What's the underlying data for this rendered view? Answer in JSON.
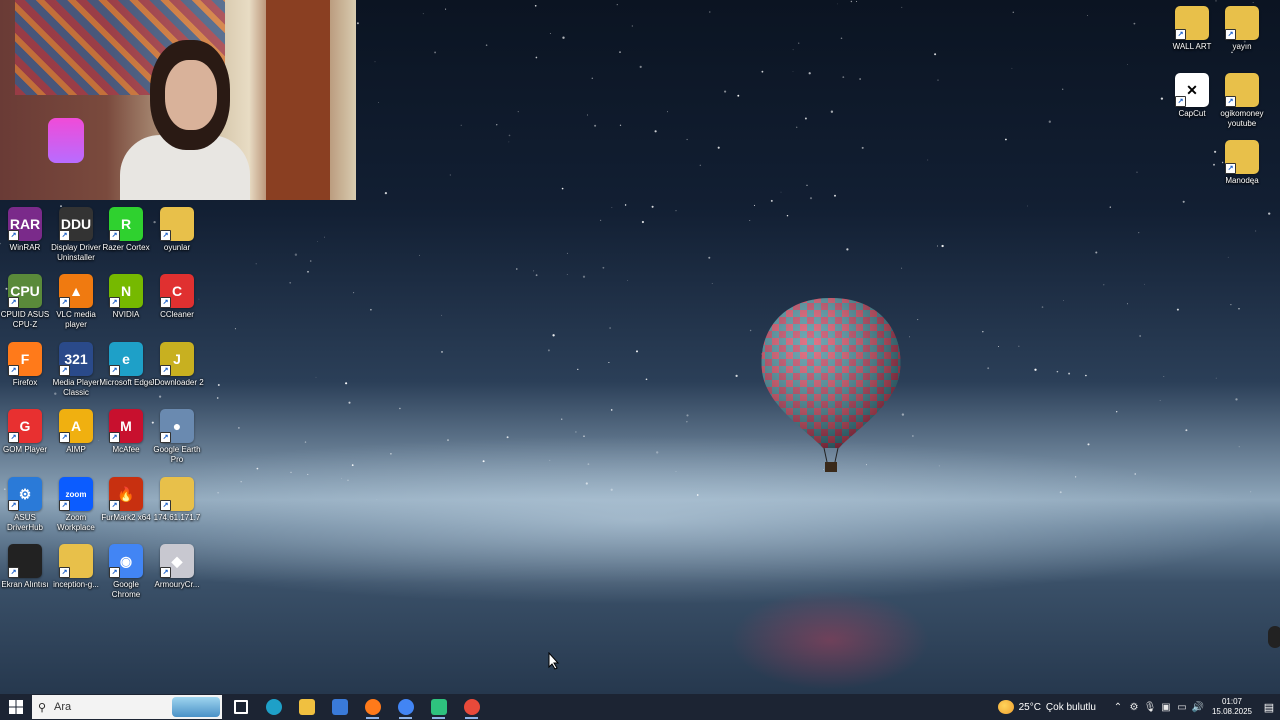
{
  "desktop": {
    "left_icons": [
      {
        "label": "WinRAR",
        "icon": "winrar-icon",
        "color": "#7a2a8a",
        "short": "RAR"
      },
      {
        "label": "Display Driver Uninstaller",
        "icon": "ddu-icon",
        "color": "#333333",
        "short": "DDU"
      },
      {
        "label": "Razer Cortex",
        "icon": "razer-cortex-icon",
        "color": "#2fd12f",
        "short": "R"
      },
      {
        "label": "oyunlar",
        "icon": "folder-icon",
        "color": "#e8c04a",
        "short": ""
      },
      {
        "label": "CPUID ASUS CPU-Z",
        "icon": "cpuz-icon",
        "color": "#5a8a3a",
        "short": "CPU"
      },
      {
        "label": "VLC media player",
        "icon": "vlc-icon",
        "color": "#f07a10",
        "short": "▲"
      },
      {
        "label": "NVIDIA",
        "icon": "nvidia-icon",
        "color": "#76b900",
        "short": "N"
      },
      {
        "label": "CCleaner",
        "icon": "ccleaner-icon",
        "color": "#e03030",
        "short": "C"
      },
      {
        "label": "Firefox",
        "icon": "firefox-icon",
        "color": "#ff7a1a",
        "short": "F"
      },
      {
        "label": "Media Player Classic",
        "icon": "mpc-icon",
        "color": "#2a4a8a",
        "short": "321"
      },
      {
        "label": "Microsoft Edge",
        "icon": "edge-icon",
        "color": "#1ea0c8",
        "short": "e"
      },
      {
        "label": "JDownloader 2",
        "icon": "jdownloader-icon",
        "color": "#c8b020",
        "short": "J"
      },
      {
        "label": "GOM Player",
        "icon": "gom-player-icon",
        "color": "#e83030",
        "short": "G"
      },
      {
        "label": "AIMP",
        "icon": "aimp-icon",
        "color": "#f0b010",
        "short": "A"
      },
      {
        "label": "McAfee",
        "icon": "mcafee-icon",
        "color": "#c8102e",
        "short": "M"
      },
      {
        "label": "Google Earth Pro",
        "icon": "google-earth-icon",
        "color": "#6a8ab0",
        "short": "●"
      },
      {
        "label": "ASUS DriverHub",
        "icon": "asus-driverhub-icon",
        "color": "#2a7ad8",
        "short": "⚙"
      },
      {
        "label": "Zoom Workplace",
        "icon": "zoom-icon",
        "color": "#0b5cff",
        "short": "zoom"
      },
      {
        "label": "FurMark2 x64",
        "icon": "furmark-icon",
        "color": "#c83010",
        "short": "🔥"
      },
      {
        "label": "174.61.171.7",
        "icon": "winrar-archive-icon",
        "color": "#e8c04a",
        "short": ""
      },
      {
        "label": "Ekran Alıntısı",
        "icon": "screenshot-thumbnail-icon",
        "color": "#222222",
        "short": ""
      },
      {
        "label": "inception-g...",
        "icon": "folder-icon",
        "color": "#e8c04a",
        "short": ""
      },
      {
        "label": "Google Chrome",
        "icon": "chrome-icon",
        "color": "#4285f4",
        "short": "◉"
      },
      {
        "label": "ArmouryCr...",
        "icon": "armoury-crate-icon",
        "color": "#c8c8d0",
        "short": "◆"
      }
    ],
    "right_icons": [
      {
        "label": "WALL ART",
        "icon": "folder-icon",
        "color": "#e8c04a",
        "short": ""
      },
      {
        "label": "yayın",
        "icon": "winrar-archive-icon",
        "color": "#e8c04a",
        "short": ""
      },
      {
        "label": "CapCut",
        "icon": "capcut-icon",
        "color": "#ffffff",
        "short": "✕"
      },
      {
        "label": "ogikomoney youtube",
        "icon": "winrar-archive-icon",
        "color": "#e8c04a",
        "short": ""
      },
      {
        "label": "Manodea",
        "icon": "winrar-archive-icon",
        "color": "#e8c04a",
        "short": ""
      }
    ]
  },
  "taskbar": {
    "search_placeholder": "Ara",
    "apps": [
      {
        "name": "task-view-icon",
        "color": "#ffffff"
      },
      {
        "name": "edge-icon",
        "color": "#1ea0c8"
      },
      {
        "name": "file-explorer-icon",
        "color": "#f0c040"
      },
      {
        "name": "microsoft-store-icon",
        "color": "#3a7ad8"
      },
      {
        "name": "firefox-icon",
        "color": "#ff7a1a"
      },
      {
        "name": "chrome-icon",
        "color": "#4285f4"
      },
      {
        "name": "chat-app-icon",
        "color": "#2ec27e"
      },
      {
        "name": "chrome-icon",
        "color": "#e84a3a"
      }
    ],
    "weather": {
      "temperature": "25°C",
      "condition": "Çok bulutlu"
    },
    "clock": {
      "time": "01:07",
      "date": "15.08.2025"
    }
  }
}
